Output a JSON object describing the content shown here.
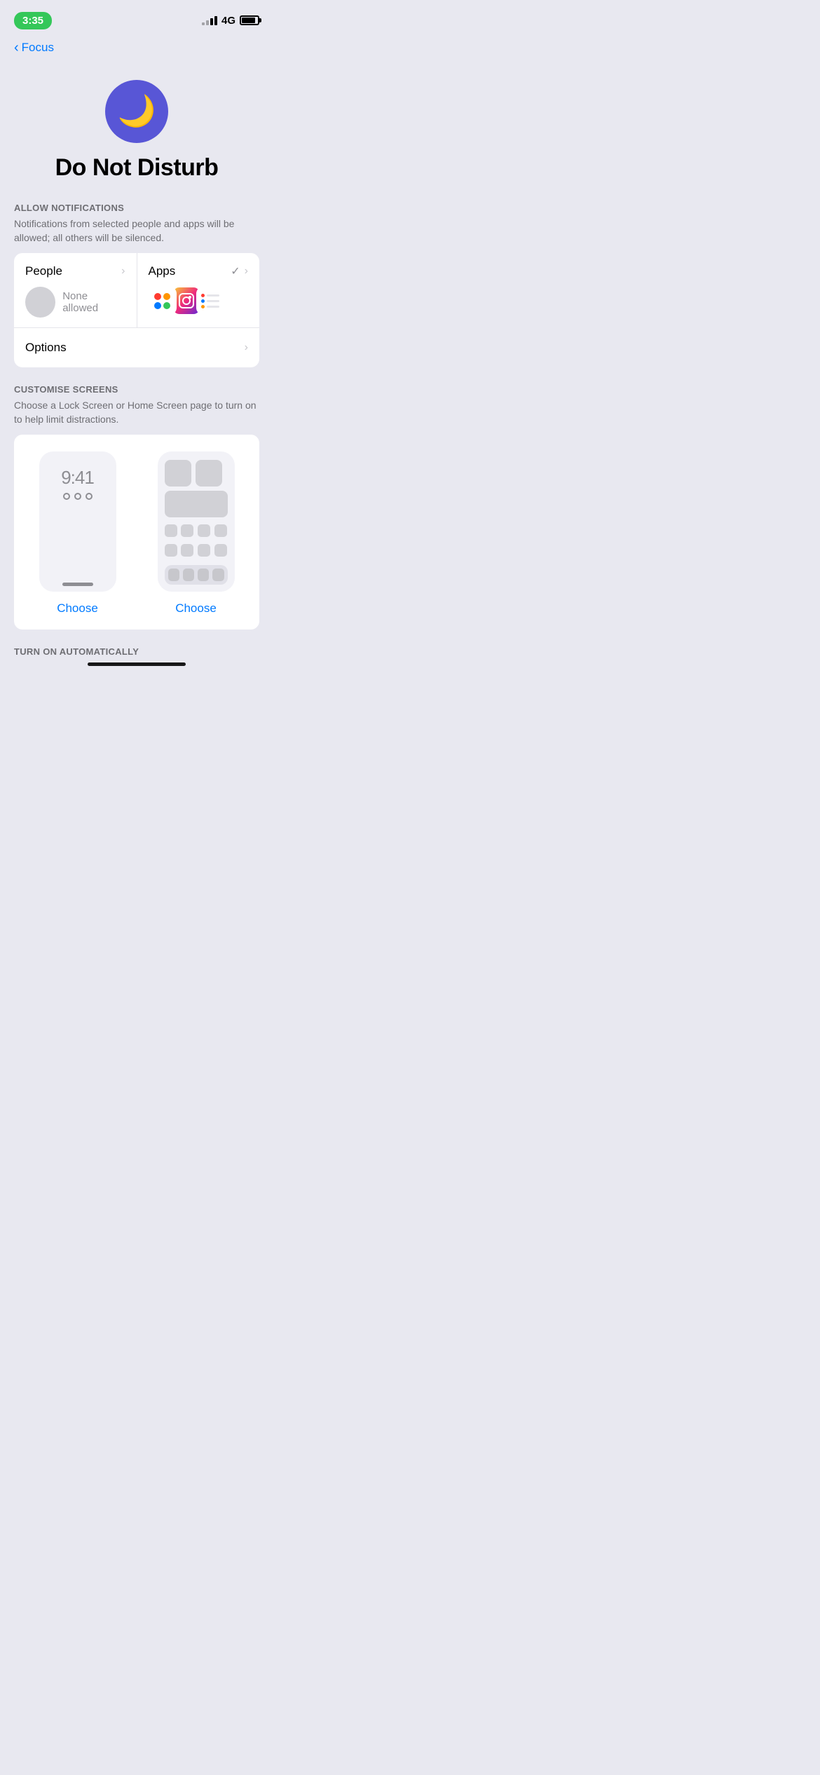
{
  "statusBar": {
    "time": "3:35",
    "network": "4G"
  },
  "navigation": {
    "backLabel": "Focus"
  },
  "hero": {
    "title": "Do Not Disturb",
    "iconName": "moon-icon"
  },
  "allowNotifications": {
    "sectionLabel": "ALLOW NOTIFICATIONS",
    "description": "Notifications from selected people and apps will be allowed; all others will be silenced.",
    "peopleCell": {
      "title": "People",
      "subtitle": "None allowed"
    },
    "appsCell": {
      "title": "Apps"
    },
    "optionsRow": {
      "title": "Options"
    }
  },
  "customiseScreens": {
    "sectionLabel": "CUSTOMISE SCREENS",
    "description": "Choose a Lock Screen or Home Screen page to turn on to help limit distractions.",
    "lockScreen": {
      "chooseLabel": "Choose",
      "time": "9:41"
    },
    "homeScreen": {
      "chooseLabel": "Choose"
    }
  },
  "turnOnAutomatically": {
    "sectionLabel": "TURN ON AUTOMATICALLY"
  }
}
